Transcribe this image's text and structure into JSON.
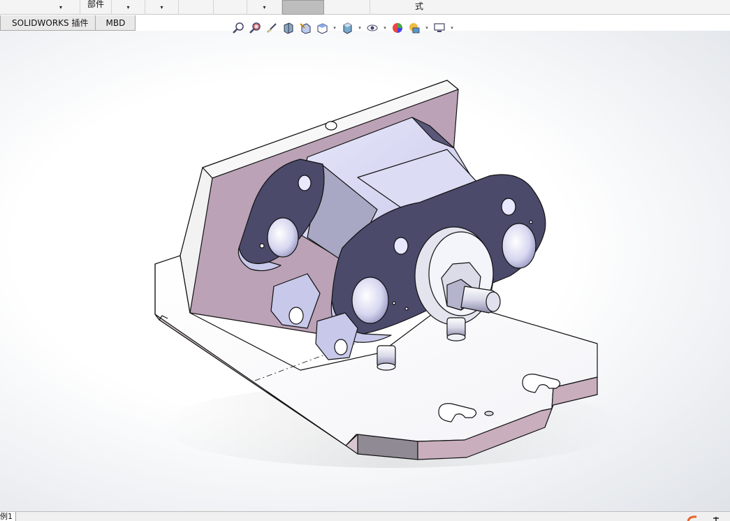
{
  "ribbon": {
    "assembly_label": "部件",
    "style_label": "式",
    "dropdown_glyph": "▾"
  },
  "tabs": [
    {
      "label": "SOLIDWORKS 插件"
    },
    {
      "label": "MBD"
    }
  ],
  "hud_toolbar": {
    "icons": [
      "zoom-to-fit-icon",
      "zoom-to-area-icon",
      "previous-view-icon",
      "section-view-icon",
      "dynamic-annotation-view-icon",
      "view-orientation-icon",
      "display-style-icon",
      "hide-show-items-icon",
      "edit-appearance-icon",
      "apply-scene-icon",
      "view-settings-icon"
    ],
    "dropdown_glyph": "▾"
  },
  "status": {
    "sheet_label": "例1"
  },
  "colors": {
    "part_face_dark": "#4b4a6b",
    "part_face_light": "#dcdcf5",
    "plate_top": "#ffffff",
    "plate_side": "#c2a8b8",
    "edge": "#111111"
  }
}
